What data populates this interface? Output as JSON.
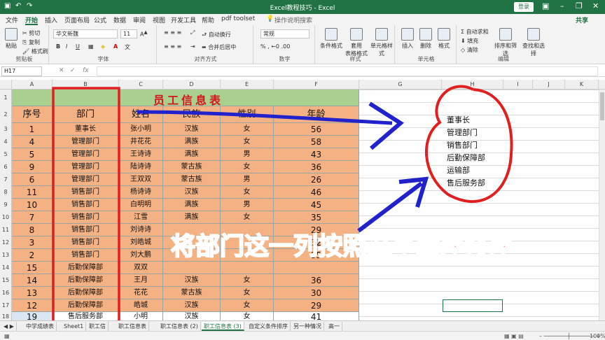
{
  "window": {
    "title": "Excel教程技巧 - Excel",
    "login": "登录"
  },
  "menu": [
    "文件",
    "开始",
    "插入",
    "页面布局",
    "公式",
    "数据",
    "审阅",
    "视图",
    "开发工具",
    "帮助",
    "pdf toolset",
    "操作说明搜索"
  ],
  "share": "共享",
  "ribbon": {
    "clipboard": {
      "label": "剪贴板",
      "paste": "粘贴",
      "cut": "剪切",
      "copy": "复制",
      "painter": "格式刷"
    },
    "font": {
      "label": "字体",
      "family": "华文新魏",
      "size": "11"
    },
    "align": {
      "label": "对齐方式",
      "wrap": "自动换行",
      "merge": "合并后居中"
    },
    "number": {
      "label": "数字",
      "format": "常规"
    },
    "styles": {
      "label": "样式",
      "conditional": "条件格式",
      "table": "套用\n表格格式",
      "cell": "单元格样式"
    },
    "cells": {
      "label": "单元格",
      "insert": "插入",
      "delete": "删除",
      "format": "格式"
    },
    "editing": {
      "label": "编辑",
      "autosum": "自动求和",
      "fill": "填充",
      "clear": "清除",
      "sort": "排序和筛选",
      "find": "查找和选择"
    }
  },
  "formula_bar": {
    "name_box": "H17",
    "fx": "fx"
  },
  "columns": [
    "A",
    "B",
    "C",
    "D",
    "E",
    "F",
    "G",
    "H",
    "I",
    "J",
    "K"
  ],
  "sheet": {
    "title": "员工信息表",
    "headers": [
      "序号",
      "部门",
      "姓名",
      "民族",
      "性别",
      "年龄"
    ],
    "rows": [
      [
        "1",
        "董事长",
        "张小明",
        "汉族",
        "女",
        "56"
      ],
      [
        "4",
        "管理部门",
        "井花花",
        "满族",
        "女",
        "58"
      ],
      [
        "5",
        "管理部门",
        "王诗诗",
        "满族",
        "男",
        "43"
      ],
      [
        "9",
        "管理部门",
        "陆诗诗",
        "蒙古族",
        "女",
        "36"
      ],
      [
        "6",
        "管理部门",
        "王双双",
        "蒙古族",
        "男",
        "26"
      ],
      [
        "11",
        "销售部门",
        "杨诗诗",
        "汉族",
        "女",
        "46"
      ],
      [
        "10",
        "销售部门",
        "白明明",
        "满族",
        "男",
        "45"
      ],
      [
        "7",
        "销售部门",
        "江雪",
        "满族",
        "女",
        "35"
      ],
      [
        "8",
        "销售部门",
        "刘诗诗",
        "",
        "",
        "29"
      ],
      [
        "3",
        "销售部门",
        "刘皓城",
        "",
        "",
        "32"
      ],
      [
        "2",
        "销售部门",
        "刘大鹏",
        "",
        "",
        "35"
      ],
      [
        "15",
        "后勤保障部",
        "双双",
        "",
        "",
        ""
      ],
      [
        "14",
        "后勤保障部",
        "王月",
        "汉族",
        "女",
        "36"
      ],
      [
        "13",
        "后勤保障部",
        "花花",
        "蒙古族",
        "女",
        "30"
      ],
      [
        "12",
        "后勤保障部",
        "皓城",
        "汉族",
        "女",
        "29"
      ],
      [
        "19",
        "售后服务部",
        "小明",
        "汉族",
        "女",
        "41"
      ]
    ],
    "row_numbers": [
      "1",
      "2",
      "3",
      "4",
      "5",
      "6",
      "7",
      "8",
      "9",
      "10",
      "11",
      "12",
      "13",
      "14",
      "15",
      "16",
      "17",
      "18"
    ]
  },
  "annotation_list": [
    "董事长",
    "管理部门",
    "销售部门",
    "后勤保障部",
    "运输部",
    "售后服务部"
  ],
  "overlay_caption": "将部门这一列按照这个顺序排序",
  "tabs": [
    "中学成绩表",
    "Sheet1",
    "职工信",
    "职工信息表",
    "职工信息表 (2)",
    "职工信息表 (3)",
    "自定义条件排序",
    "另一种情况",
    "高一"
  ],
  "status": {
    "zoom": "100%"
  },
  "colors": {
    "excel_green": "#217346",
    "header_green": "#a9d08e",
    "cell_orange": "#f4b183",
    "annotation_red": "#e02020",
    "arrow_blue": "#2222cc"
  }
}
